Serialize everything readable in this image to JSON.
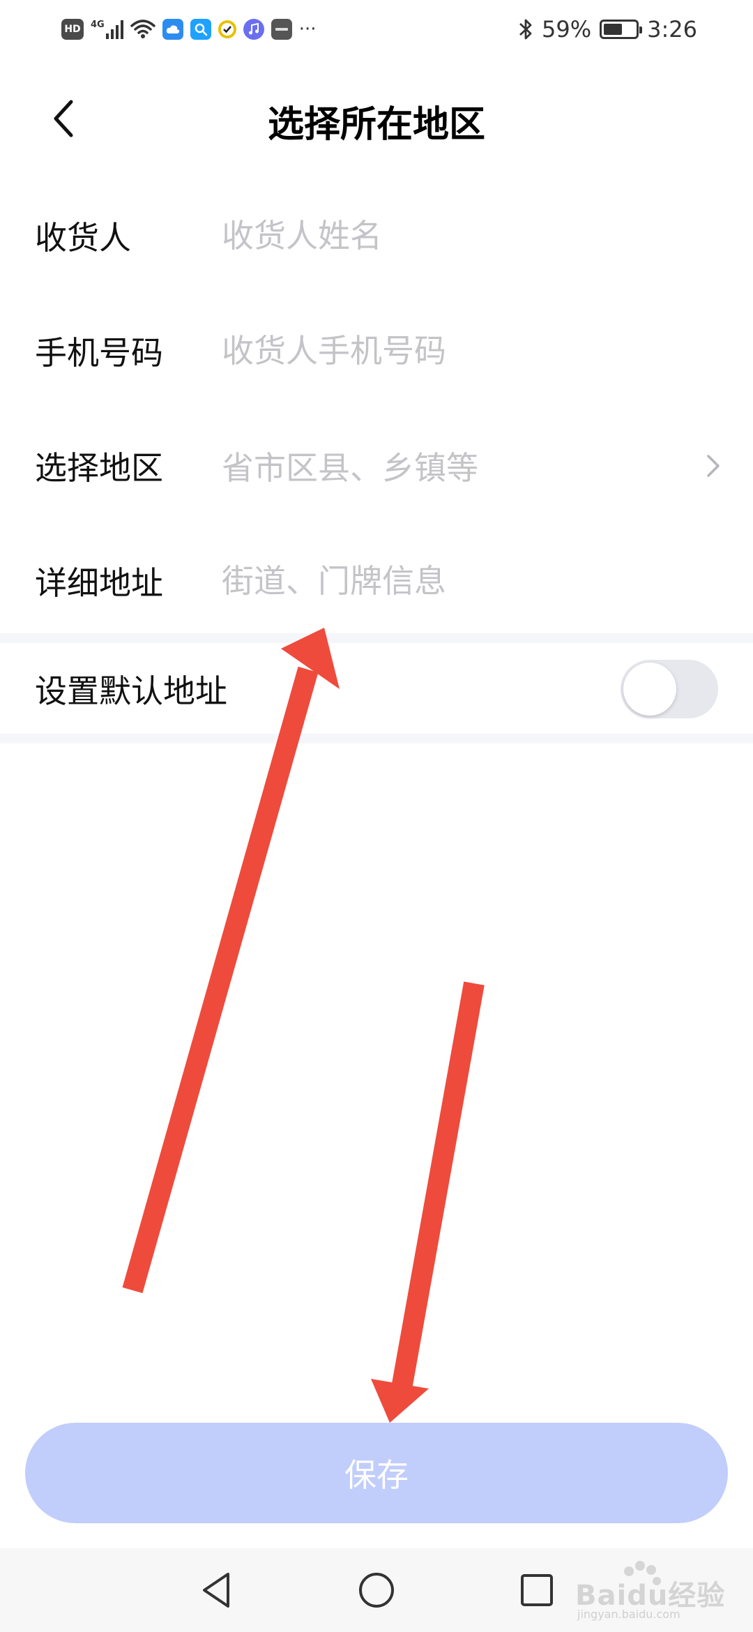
{
  "status_bar": {
    "left_icons": [
      "hd-icon",
      "signal-4g-icon",
      "wifi-icon",
      "cloud-app-icon",
      "search-app-icon",
      "check-app-icon",
      "music-app-icon",
      "huawei-app-icon"
    ],
    "hd_label": "HD",
    "network_label": "4G",
    "more_label": "···",
    "battery_percent": "59%",
    "battery_level": 0.59,
    "time": "3:26"
  },
  "header": {
    "title": "选择所在地区"
  },
  "form": {
    "rows": [
      {
        "label": "收货人",
        "placeholder": "收货人姓名",
        "value": ""
      },
      {
        "label": "手机号码",
        "placeholder": "收货人手机号码",
        "value": ""
      },
      {
        "label": "选择地区",
        "placeholder": "省市区县、乡镇等",
        "value": ""
      },
      {
        "label": "详细地址",
        "placeholder": "街道、门牌信息",
        "value": ""
      }
    ]
  },
  "default_address": {
    "label": "设置默认地址",
    "enabled": false
  },
  "save_button": {
    "label": "保存"
  },
  "colors": {
    "accent_disabled": "#c1cdfb",
    "placeholder": "#c3c3c8",
    "annotation_arrow": "#ee4b3c",
    "divider": "#f5f6fa"
  },
  "watermark": {
    "brand": "Baidu经验",
    "url": "jingyan.baidu.com"
  }
}
